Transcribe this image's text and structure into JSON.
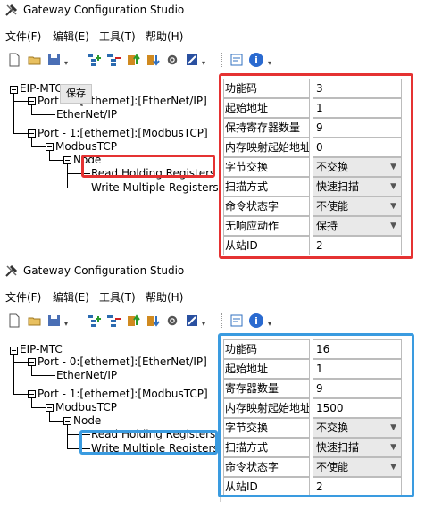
{
  "panels": [
    {
      "title": "Gateway Configuration Studio",
      "menu": [
        "文件(F)",
        "编辑(E)",
        "工具(T)",
        "帮助(H)"
      ],
      "tooltip": "保存",
      "tree": {
        "root": "EIP-MTC",
        "port0": "Port - 0:[ethernet]:[EtherNet/IP]",
        "port0_child": "EtherNet/IP",
        "port1": "Port - 1:[ethernet]:[ModbusTCP]",
        "modbus": "ModbusTCP",
        "node": "Node",
        "read": "Read Holding Registers",
        "write": "Write Multiple Registers"
      },
      "properties": [
        {
          "label": "功能码",
          "value": "3"
        },
        {
          "label": "起始地址",
          "value": "1"
        },
        {
          "label": "保持寄存器数量",
          "value": "9"
        },
        {
          "label": "内存映射起始地址",
          "value": "0"
        },
        {
          "label": "字节交换",
          "value": "不交换",
          "select": true
        },
        {
          "label": "扫描方式",
          "value": "快速扫描",
          "select": true
        },
        {
          "label": "命令状态字",
          "value": "不使能",
          "select": true
        },
        {
          "label": "无响应动作",
          "value": "保持",
          "select": true
        },
        {
          "label": "从站ID",
          "value": "2"
        }
      ]
    },
    {
      "title": "Gateway Configuration Studio",
      "menu": [
        "文件(F)",
        "编辑(E)",
        "工具(T)",
        "帮助(H)"
      ],
      "tree": {
        "root": "EIP-MTC",
        "port0": "Port - 0:[ethernet]:[EtherNet/IP]",
        "port0_child": "EtherNet/IP",
        "port1": "Port - 1:[ethernet]:[ModbusTCP]",
        "modbus": "ModbusTCP",
        "node": "Node",
        "read": "Read Holding Registers",
        "write": "Write Multiple Registers"
      },
      "properties": [
        {
          "label": "功能码",
          "value": "16"
        },
        {
          "label": "起始地址",
          "value": "1"
        },
        {
          "label": "寄存器数量",
          "value": "9"
        },
        {
          "label": "内存映射起始地址",
          "value": "1500"
        },
        {
          "label": "字节交换",
          "value": "不交换",
          "select": true
        },
        {
          "label": "扫描方式",
          "value": "快速扫描",
          "select": true
        },
        {
          "label": "命令状态字",
          "value": "不使能",
          "select": true
        },
        {
          "label": "从站ID",
          "value": "2"
        }
      ]
    }
  ],
  "toolbar_icons": [
    "new-file-icon",
    "open-folder-icon",
    "save-icon",
    "add-node-icon",
    "delete-node-icon",
    "upload-icon",
    "download-icon",
    "settings-icon",
    "build-icon",
    "config-icon",
    "info-icon"
  ],
  "colors": {
    "highlight_red": "#e53232",
    "highlight_blue": "#3a9be0"
  }
}
